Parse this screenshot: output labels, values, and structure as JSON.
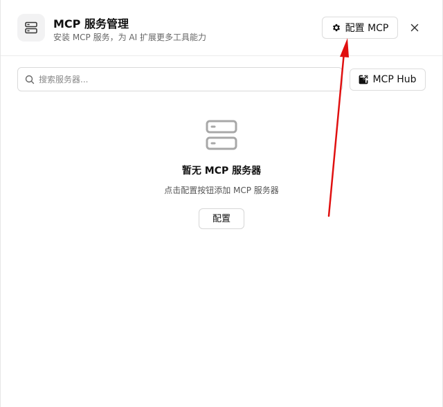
{
  "header": {
    "title": "MCP 服务管理",
    "subtitle": "安装 MCP 服务，为 AI 扩展更多工具能力",
    "config_button_label": "配置 MCP"
  },
  "search": {
    "placeholder": "搜索服务器...",
    "value": ""
  },
  "hub_button_label": "MCP Hub",
  "empty_state": {
    "title": "暂无 MCP 服务器",
    "description": "点击配置按钮添加 MCP 服务器",
    "button_label": "配置"
  },
  "colors": {
    "annotation_arrow": "#e01010",
    "border": "#dcdcdc",
    "icon_gray": "#a8a8a8"
  },
  "icons": [
    "server-icon",
    "gear-icon",
    "close-icon",
    "search-icon",
    "external-link-icon"
  ]
}
